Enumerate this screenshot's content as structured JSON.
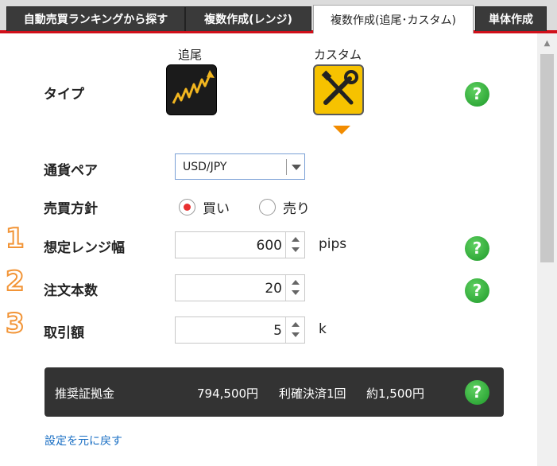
{
  "tabs": [
    {
      "label": "自動売買ランキングから探す"
    },
    {
      "label": "複数作成(レンジ)"
    },
    {
      "label": "複数作成(追尾･カスタム)"
    },
    {
      "label": "単体作成"
    }
  ],
  "type": {
    "label": "タイプ",
    "options": [
      {
        "label": "追尾",
        "icon": "trailing-chart-icon"
      },
      {
        "label": "カスタム",
        "icon": "tools-icon"
      }
    ]
  },
  "currency": {
    "label": "通貨ペア",
    "value": "USD/JPY"
  },
  "side": {
    "label": "売買方針",
    "buy": "買い",
    "sell": "売り"
  },
  "steps": [
    "1",
    "2",
    "3"
  ],
  "range": {
    "label": "想定レンジ幅",
    "value": "600",
    "unit": "pips"
  },
  "orders": {
    "label": "注文本数",
    "value": "20"
  },
  "amount": {
    "label": "取引額",
    "value": "5",
    "unit": "k"
  },
  "summary": {
    "label": "推奨証拠金",
    "margin": "794,500円",
    "settle": "利確決済1回",
    "profit": "約1,500円"
  },
  "help_glyph": "?",
  "reset_link": "設定を元に戻す",
  "colors": {
    "tab_red": "#d0101a",
    "help_green": "#2aa637",
    "accent_orange": "#f28c00",
    "link_blue": "#1a6fc4"
  }
}
